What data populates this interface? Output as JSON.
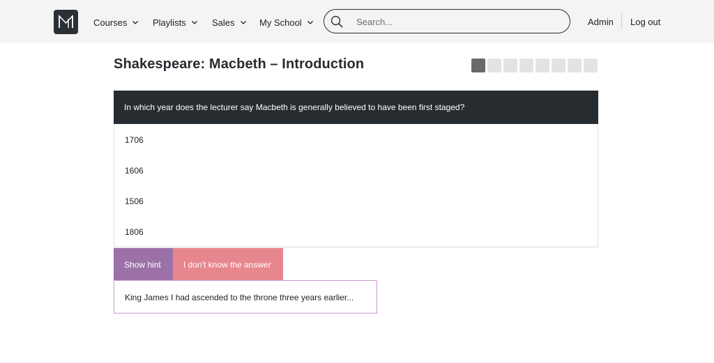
{
  "navbar": {
    "logo_icon": "m-logo-icon",
    "menus": [
      {
        "label": "Courses"
      },
      {
        "label": "Playlists"
      },
      {
        "label": "Sales"
      },
      {
        "label": "My School"
      }
    ],
    "search": {
      "placeholder": "Search...",
      "value": ""
    },
    "admin_label": "Admin",
    "logout_label": "Log out"
  },
  "page": {
    "title": "Shakespeare: Macbeth – Introduction"
  },
  "progress": {
    "total_steps": 8,
    "current_step": 1
  },
  "quiz": {
    "question": "In which year does the lecturer say Macbeth is generally believed to have been first staged?",
    "answers": [
      "1706",
      "1606",
      "1506",
      "1806"
    ],
    "show_hint_label": "Show hint",
    "dont_know_label": "I don't know the answer",
    "hint_text": "King James I had ascended to the throne three years earlier..."
  },
  "colors": {
    "navbar_bg": "#f4f4f4",
    "question_bg": "#272c31",
    "hint_button": "#9c71a7",
    "dont_know_button": "#e8868e",
    "progress_current": "#696969",
    "progress_pending": "#e2e3e4"
  }
}
